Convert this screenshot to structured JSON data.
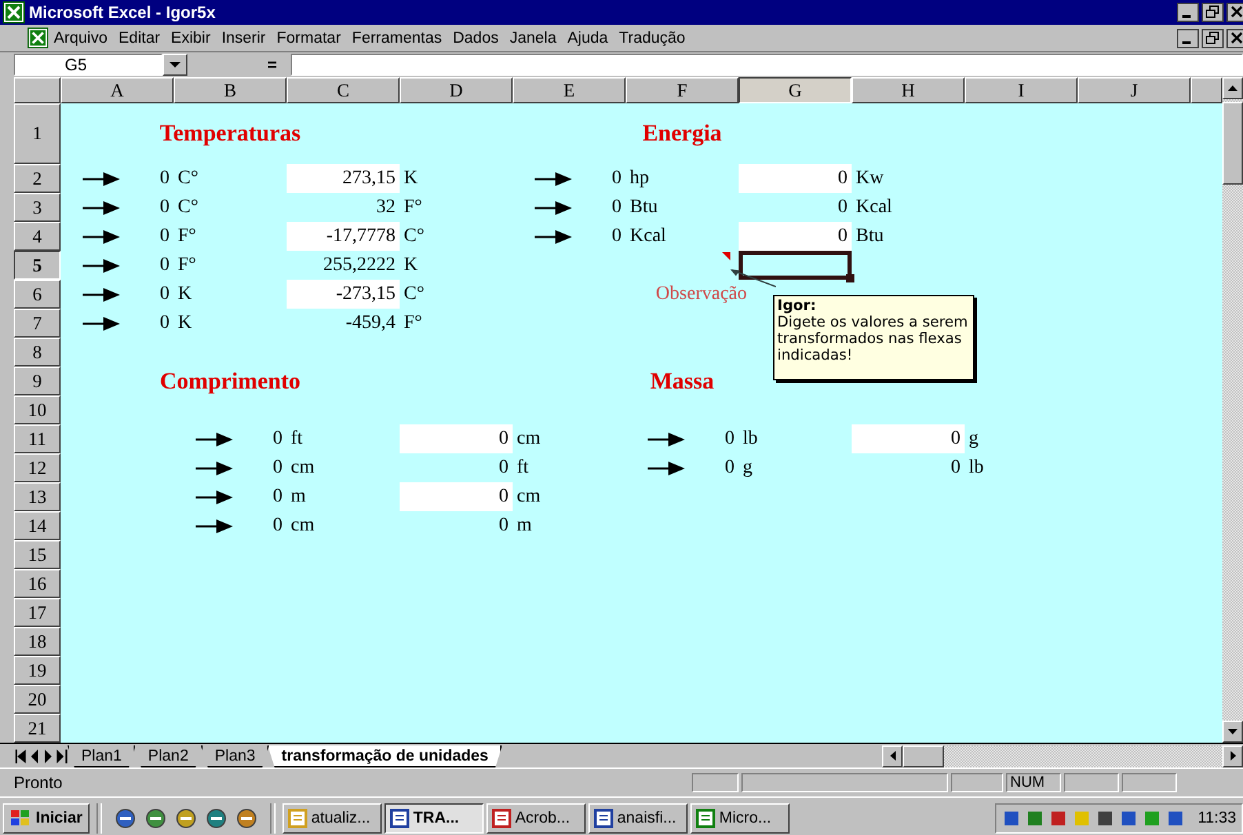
{
  "window": {
    "title": "Microsoft Excel - Igor5x"
  },
  "menu": [
    {
      "label": "Arquivo"
    },
    {
      "label": "Editar"
    },
    {
      "label": "Exibir"
    },
    {
      "label": "Inserir"
    },
    {
      "label": "Formatar"
    },
    {
      "label": "Ferramentas"
    },
    {
      "label": "Dados"
    },
    {
      "label": "Janela"
    },
    {
      "label": "Ajuda"
    },
    {
      "label": "Tradução"
    }
  ],
  "formula_bar": {
    "name_box": "G5",
    "equals": "="
  },
  "columns": [
    {
      "label": "A",
      "selected": false
    },
    {
      "label": "B",
      "selected": false
    },
    {
      "label": "C",
      "selected": false
    },
    {
      "label": "D",
      "selected": false
    },
    {
      "label": "E",
      "selected": false
    },
    {
      "label": "F",
      "selected": false
    },
    {
      "label": "G",
      "selected": true
    },
    {
      "label": "H",
      "selected": false
    },
    {
      "label": "I",
      "selected": false
    },
    {
      "label": "J",
      "selected": false
    }
  ],
  "rows": [
    {
      "label": "1",
      "selected": false,
      "cells": [
        null,
        {
          "kind": "title",
          "text": "Temperaturas"
        },
        null,
        null,
        null,
        {
          "kind": "title",
          "text": "Energia"
        }
      ]
    },
    {
      "label": "2",
      "selected": false,
      "cells": [
        {
          "kind": "value",
          "text": "0",
          "arrow": true,
          "filled": false
        },
        {
          "kind": "unit",
          "text": "C°"
        },
        {
          "kind": "value",
          "text": "273,15",
          "arrow": false,
          "filled": true
        },
        {
          "kind": "unit",
          "text": "K"
        },
        {
          "kind": "value",
          "text": "0",
          "arrow": true,
          "filled": false
        },
        {
          "kind": "unit",
          "text": "hp"
        },
        {
          "kind": "value",
          "text": "0",
          "arrow": false,
          "filled": true
        },
        {
          "kind": "unit",
          "text": "Kw"
        }
      ]
    },
    {
      "label": "3",
      "selected": false,
      "cells": [
        {
          "kind": "value",
          "text": "0",
          "arrow": true,
          "filled": false
        },
        {
          "kind": "unit",
          "text": "C°"
        },
        {
          "kind": "value",
          "text": "32",
          "arrow": false,
          "filled": false
        },
        {
          "kind": "unit",
          "text": "F°"
        },
        {
          "kind": "value",
          "text": "0",
          "arrow": true,
          "filled": false
        },
        {
          "kind": "unit",
          "text": "Btu"
        },
        {
          "kind": "value",
          "text": "0",
          "arrow": false,
          "filled": false
        },
        {
          "kind": "unit",
          "text": "Kcal"
        }
      ]
    },
    {
      "label": "4",
      "selected": false,
      "cells": [
        {
          "kind": "value",
          "text": "0",
          "arrow": true,
          "filled": false
        },
        {
          "kind": "unit",
          "text": "F°"
        },
        {
          "kind": "value",
          "text": "-17,7778",
          "arrow": false,
          "filled": true
        },
        {
          "kind": "unit",
          "text": "C°"
        },
        {
          "kind": "value",
          "text": "0",
          "arrow": true,
          "filled": false
        },
        {
          "kind": "unit",
          "text": "Kcal"
        },
        {
          "kind": "value",
          "text": "0",
          "arrow": false,
          "filled": true
        },
        {
          "kind": "unit",
          "text": "Btu"
        }
      ]
    },
    {
      "label": "5",
      "selected": true,
      "cells": [
        {
          "kind": "value",
          "text": "0",
          "arrow": true,
          "filled": false
        },
        {
          "kind": "unit",
          "text": "F°"
        },
        {
          "kind": "value",
          "text": "255,2222",
          "arrow": false,
          "filled": false
        },
        {
          "kind": "unit",
          "text": "K"
        }
      ]
    },
    {
      "label": "6",
      "selected": false,
      "cells": [
        {
          "kind": "value",
          "text": "0",
          "arrow": true,
          "filled": false
        },
        {
          "kind": "unit",
          "text": "K"
        },
        {
          "kind": "value",
          "text": "-273,15",
          "arrow": false,
          "filled": true
        },
        {
          "kind": "unit",
          "text": "C°"
        },
        null,
        {
          "kind": "note",
          "text": "Observação"
        }
      ]
    },
    {
      "label": "7",
      "selected": false,
      "cells": [
        {
          "kind": "value",
          "text": "0",
          "arrow": true,
          "filled": false
        },
        {
          "kind": "unit",
          "text": "K"
        },
        {
          "kind": "value",
          "text": "-459,4",
          "arrow": false,
          "filled": false
        },
        {
          "kind": "unit",
          "text": "F°"
        }
      ]
    },
    {
      "label": "8",
      "selected": false,
      "cells": []
    },
    {
      "label": "9",
      "selected": false,
      "cells": [
        null,
        {
          "kind": "title",
          "text": "Comprimento"
        },
        null,
        null,
        null,
        {
          "kind": "title",
          "text": "Massa"
        }
      ]
    },
    {
      "label": "10",
      "selected": false,
      "cells": []
    },
    {
      "label": "11",
      "selected": false,
      "cells": [
        null,
        {
          "kind": "value",
          "text": "0",
          "arrow": true,
          "filled": false
        },
        {
          "kind": "unit",
          "text": "ft"
        },
        {
          "kind": "value",
          "text": "0",
          "arrow": false,
          "filled": true
        },
        {
          "kind": "unit",
          "text": "cm"
        },
        {
          "kind": "value",
          "text": "0",
          "arrow": true,
          "filled": false
        },
        {
          "kind": "unit",
          "text": "lb"
        },
        {
          "kind": "value",
          "text": "0",
          "arrow": false,
          "filled": true
        },
        {
          "kind": "unit",
          "text": "g"
        }
      ]
    },
    {
      "label": "12",
      "selected": false,
      "cells": [
        null,
        {
          "kind": "value",
          "text": "0",
          "arrow": true,
          "filled": false
        },
        {
          "kind": "unit",
          "text": "cm"
        },
        {
          "kind": "value",
          "text": "0",
          "arrow": false,
          "filled": false
        },
        {
          "kind": "unit",
          "text": "ft"
        },
        {
          "kind": "value",
          "text": "0",
          "arrow": true,
          "filled": false
        },
        {
          "kind": "unit",
          "text": "g"
        },
        {
          "kind": "value",
          "text": "0",
          "arrow": false,
          "filled": false
        },
        {
          "kind": "unit",
          "text": "lb"
        }
      ]
    },
    {
      "label": "13",
      "selected": false,
      "cells": [
        null,
        {
          "kind": "value",
          "text": "0",
          "arrow": true,
          "filled": false
        },
        {
          "kind": "unit",
          "text": "m"
        },
        {
          "kind": "value",
          "text": "0",
          "arrow": false,
          "filled": true
        },
        {
          "kind": "unit",
          "text": "cm"
        }
      ]
    },
    {
      "label": "14",
      "selected": false,
      "cells": [
        null,
        {
          "kind": "value",
          "text": "0",
          "arrow": true,
          "filled": false
        },
        {
          "kind": "unit",
          "text": "cm"
        },
        {
          "kind": "value",
          "text": "0",
          "arrow": false,
          "filled": false
        },
        {
          "kind": "unit",
          "text": "m"
        }
      ]
    },
    {
      "label": "15",
      "selected": false,
      "cells": []
    },
    {
      "label": "16",
      "selected": false,
      "cells": []
    },
    {
      "label": "17",
      "selected": false,
      "cells": []
    },
    {
      "label": "18",
      "selected": false,
      "cells": []
    },
    {
      "label": "19",
      "selected": false,
      "cells": []
    },
    {
      "label": "20",
      "selected": false,
      "cells": []
    },
    {
      "label": "21",
      "selected": false,
      "cells": []
    }
  ],
  "comment": {
    "author": "Igor:",
    "text": "Digete os valores a serem transformados nas flexas indicadas!"
  },
  "sheet_tabs": [
    {
      "label": "Plan1",
      "selected": false
    },
    {
      "label": "Plan2",
      "selected": false
    },
    {
      "label": "Plan3",
      "selected": false
    },
    {
      "label": "transformação de unidades",
      "selected": true
    }
  ],
  "status_bar": {
    "text": "Pronto",
    "indicators": [
      "NUM"
    ]
  },
  "taskbar": {
    "start": "Iniciar",
    "tasks": [
      {
        "label": "atualiz...",
        "selected": false
      },
      {
        "label": "TRA...",
        "selected": true
      },
      {
        "label": "Acrob...",
        "selected": false
      },
      {
        "label": "anaisfi...",
        "selected": false
      },
      {
        "label": "Micro...",
        "selected": false
      }
    ],
    "clock": "11:33"
  }
}
